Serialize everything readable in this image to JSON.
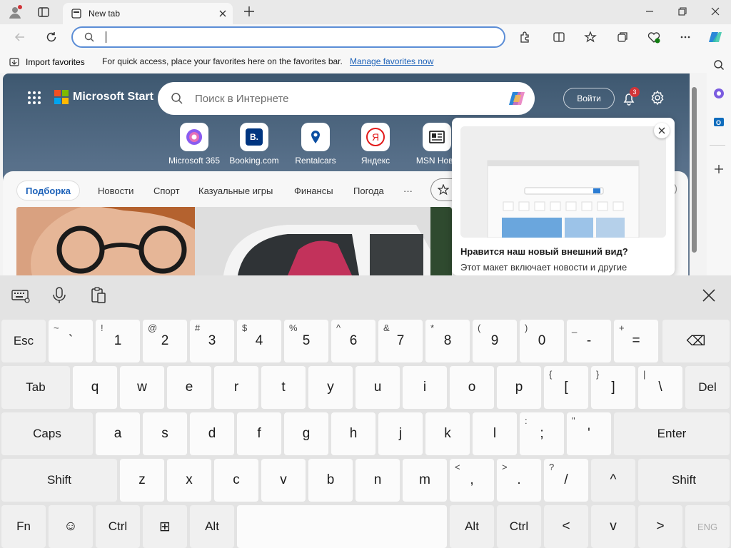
{
  "browser": {
    "tab_title": "New tab",
    "address_placeholder": ""
  },
  "favorites_bar": {
    "import_label": "Import favorites",
    "hint": "For quick access, place your favorites here on the favorites bar.",
    "manage_link": "Manage favorites now"
  },
  "page": {
    "brand": "Microsoft Start",
    "search_placeholder": "Поиск в Интернете",
    "signin_label": "Войти",
    "notification_count": "3",
    "quicklinks": [
      {
        "label": "Microsoft 365",
        "icon": "m365-icon"
      },
      {
        "label": "Booking.com",
        "icon": "booking-icon",
        "glyph": "B."
      },
      {
        "label": "Rentalcars",
        "icon": "rentalcars-icon"
      },
      {
        "label": "Яндекс",
        "icon": "yandex-icon",
        "glyph": "Я"
      },
      {
        "label": "MSN Ново",
        "icon": "msn-news-icon"
      }
    ],
    "nav_tabs": [
      "Подборка",
      "Новости",
      "Спорт",
      "Казуальные игры",
      "Финансы",
      "Погода",
      "···"
    ]
  },
  "popup": {
    "title": "Нравится наш новый внешний вид?",
    "body": "Этот макет включает новости и другие"
  },
  "keyboard": {
    "rows": [
      [
        {
          "id": "esc",
          "main": "Esc"
        },
        {
          "id": "grave",
          "sub": "~",
          "main": "`"
        },
        {
          "id": "1",
          "sub": "!",
          "main": "1"
        },
        {
          "id": "2",
          "sub": "@",
          "main": "2"
        },
        {
          "id": "3",
          "sub": "#",
          "main": "3"
        },
        {
          "id": "4",
          "sub": "$",
          "main": "4"
        },
        {
          "id": "5",
          "sub": "%",
          "main": "5"
        },
        {
          "id": "6",
          "sub": "^",
          "main": "6"
        },
        {
          "id": "7",
          "sub": "&",
          "main": "7"
        },
        {
          "id": "8",
          "sub": "*",
          "main": "8"
        },
        {
          "id": "9",
          "sub": "(",
          "main": "9"
        },
        {
          "id": "0",
          "sub": ")",
          "main": "0"
        },
        {
          "id": "minus",
          "sub": "_",
          "main": "-"
        },
        {
          "id": "equals",
          "sub": "+",
          "main": "="
        },
        {
          "id": "backspace",
          "main": "⌫"
        }
      ],
      [
        {
          "id": "tab",
          "main": "Tab"
        },
        {
          "id": "q",
          "main": "q"
        },
        {
          "id": "w",
          "main": "w"
        },
        {
          "id": "e",
          "main": "e"
        },
        {
          "id": "r",
          "main": "r"
        },
        {
          "id": "t",
          "main": "t"
        },
        {
          "id": "y",
          "main": "y"
        },
        {
          "id": "u",
          "main": "u"
        },
        {
          "id": "i",
          "main": "i"
        },
        {
          "id": "o",
          "main": "o"
        },
        {
          "id": "p",
          "main": "p"
        },
        {
          "id": "lbracket",
          "sub": "{",
          "main": "["
        },
        {
          "id": "rbracket",
          "sub": "}",
          "main": "]"
        },
        {
          "id": "backslash",
          "sub": "|",
          "main": "\\"
        },
        {
          "id": "del",
          "main": "Del"
        }
      ],
      [
        {
          "id": "caps",
          "main": "Caps"
        },
        {
          "id": "a",
          "main": "a"
        },
        {
          "id": "s",
          "main": "s"
        },
        {
          "id": "d",
          "main": "d"
        },
        {
          "id": "f",
          "main": "f"
        },
        {
          "id": "g",
          "main": "g"
        },
        {
          "id": "h",
          "main": "h"
        },
        {
          "id": "j",
          "main": "j"
        },
        {
          "id": "k",
          "main": "k"
        },
        {
          "id": "l",
          "main": "l"
        },
        {
          "id": "semicolon",
          "sub": ":",
          "main": ";"
        },
        {
          "id": "quote",
          "sub": "\"",
          "main": "'"
        },
        {
          "id": "enter",
          "main": "Enter"
        }
      ],
      [
        {
          "id": "lshift",
          "main": "Shift"
        },
        {
          "id": "z",
          "main": "z"
        },
        {
          "id": "x",
          "main": "x"
        },
        {
          "id": "c",
          "main": "c"
        },
        {
          "id": "v",
          "main": "v"
        },
        {
          "id": "b",
          "main": "b"
        },
        {
          "id": "n",
          "main": "n"
        },
        {
          "id": "m",
          "main": "m"
        },
        {
          "id": "comma",
          "sub": "<",
          "main": ","
        },
        {
          "id": "period",
          "sub": ">",
          "main": "."
        },
        {
          "id": "slash",
          "sub": "?",
          "main": "/"
        },
        {
          "id": "up",
          "main": "^"
        },
        {
          "id": "rshift",
          "main": "Shift"
        }
      ],
      [
        {
          "id": "fn",
          "main": "Fn"
        },
        {
          "id": "emoji",
          "main": "☺"
        },
        {
          "id": "lctrl",
          "main": "Ctrl"
        },
        {
          "id": "win",
          "main": "⊞"
        },
        {
          "id": "lalt",
          "main": "Alt"
        },
        {
          "id": "space",
          "main": ""
        },
        {
          "id": "ralt",
          "main": "Alt"
        },
        {
          "id": "rctrl",
          "main": "Ctrl"
        },
        {
          "id": "left",
          "main": "<"
        },
        {
          "id": "down",
          "main": "v"
        },
        {
          "id": "right",
          "main": ">"
        },
        {
          "id": "lang",
          "main": "ENG"
        }
      ]
    ]
  }
}
